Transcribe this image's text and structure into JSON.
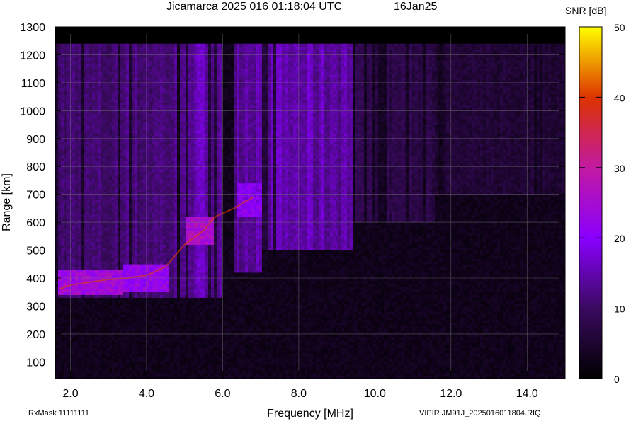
{
  "header": {
    "title": "Jicamarca 2025 016 01:18:04 UTC",
    "date": "16Jan25"
  },
  "colorbar": {
    "title": "SNR [dB]",
    "ticks": [
      "50",
      "40",
      "30",
      "20",
      "10",
      "0"
    ],
    "range": [
      0,
      50
    ],
    "colors": [
      "#000000",
      "#3a0a60",
      "#8a00ff",
      "#c21aa0",
      "#dd3300",
      "#ffff00"
    ]
  },
  "footer": {
    "rxmask": "RxMask 11111111",
    "file": "VIPIR  JM91J_2025016011804.RIQ"
  },
  "chart_data": {
    "type": "heatmap",
    "title": "Jicamarca 2025 016 01:18:04 UTC",
    "xlabel": "Frequency [MHz]",
    "ylabel": "Range [km]",
    "xlim": [
      1.6,
      15.0
    ],
    "ylim": [
      40,
      1300
    ],
    "xticks": [
      "2.0",
      "4.0",
      "6.0",
      "8.0",
      "10.0",
      "12.0",
      "14.0"
    ],
    "yticks": [
      "1300",
      "1200",
      "1100",
      "1000",
      "900",
      "800",
      "700",
      "600",
      "500",
      "400",
      "300",
      "200",
      "100"
    ],
    "data_range_km": [
      40,
      1240
    ],
    "grid": true,
    "colorbar_label": "SNR [dB]",
    "trace_o_mode": [
      {
        "f": 1.7,
        "h": 360
      },
      {
        "f": 2.0,
        "h": 375
      },
      {
        "f": 2.5,
        "h": 385
      },
      {
        "f": 3.0,
        "h": 395
      },
      {
        "f": 3.5,
        "h": 400
      },
      {
        "f": 4.0,
        "h": 410
      },
      {
        "f": 4.5,
        "h": 440
      },
      {
        "f": 5.0,
        "h": 520
      },
      {
        "f": 5.5,
        "h": 570
      },
      {
        "f": 5.8,
        "h": 620
      },
      {
        "f": 6.3,
        "h": 650
      },
      {
        "f": 6.8,
        "h": 690
      }
    ],
    "echo_regions": [
      {
        "f0": 1.6,
        "f1": 3.4,
        "h0": 330,
        "h1": 1240,
        "snr": 9
      },
      {
        "f0": 3.4,
        "f1": 4.8,
        "h0": 330,
        "h1": 1240,
        "snr": 10
      },
      {
        "f0": 4.9,
        "f1": 6.0,
        "h0": 330,
        "h1": 1240,
        "snr": 13
      },
      {
        "f0": 6.3,
        "f1": 7.0,
        "h0": 420,
        "h1": 1240,
        "snr": 13
      },
      {
        "f0": 7.0,
        "f1": 9.4,
        "h0": 500,
        "h1": 1240,
        "snr": 13
      },
      {
        "f0": 9.5,
        "f1": 11.6,
        "h0": 600,
        "h1": 1240,
        "snr": 6
      },
      {
        "f0": 11.6,
        "f1": 15.0,
        "h0": 700,
        "h1": 1240,
        "snr": 4
      }
    ],
    "strong_echo_regions": [
      {
        "f0": 1.7,
        "f1": 3.4,
        "h0": 345,
        "h1": 430,
        "snr": 24
      },
      {
        "f0": 3.4,
        "f1": 4.6,
        "h0": 355,
        "h1": 450,
        "snr": 22
      },
      {
        "f0": 5.0,
        "f1": 5.8,
        "h0": 520,
        "h1": 620,
        "snr": 26
      },
      {
        "f0": 6.4,
        "f1": 7.0,
        "h0": 620,
        "h1": 740,
        "snr": 20
      }
    ]
  }
}
